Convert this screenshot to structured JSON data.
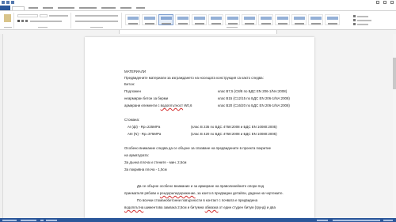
{
  "colors": {
    "accent": "#2b579a",
    "page": "#ffffff",
    "workspace": "#f3f3f3",
    "spellcheck": "#d32f2f"
  },
  "icons": [
    "save-icon",
    "undo-icon",
    "redo-icon",
    "minimize-icon",
    "maximize-icon",
    "close-icon"
  ],
  "document": {
    "lines": {
      "l01": "МАТЕРИАЛИ",
      "l02": "Предвидените материали за изграждането на носещата конструкция са както следва:",
      "l03": "Бетон:",
      "l04": "Подложен",
      "l04b": "клас В7,5 (C8/8 по БДС EN 206-1/NA:2008)",
      "l05": "неармиран бетон за берми",
      "l05b": "клас В15 (C12/15 по БДС EN 206-1/NA:2008)",
      "l06a": "армирани елементи с ",
      "l06red": "водоплътност",
      "l06c": " W0,6",
      "l06b": "клас В20 (C16/20 по БДС EN 206-1/NA:2008)",
      "l07": "Стомана:",
      "l08": "AI (фi) - Rp=225MPa",
      "l08b": "(клас В 235 по БДС 4758:2008 и БДС EN 10080:2005)",
      "l09": "AIII (N) - Rp=375MPa",
      "l09b": "(клас В 420 по БДС 4758:2008 и БДС EN 10080:2005)",
      "l10": "Особено внимание следва да се обърне за спазване на предвидените в проекта покритие",
      "l11": "на арматурата:",
      "l12": "За дънна плоча и стените    - мин. 2,5см",
      "l13": "За покривна плоча                         - 1,5см",
      "l14": "Да се обърне особено внимание и за армиране на праволинейните опори под",
      "l15a": "приемателя рябови и ",
      "l15red": "рендориледерижение",
      "l15c": ", за които в предвидни детайли, дадени на чертежите.",
      "l16": "По всички стоманобетонни повърхности в контакт с почвата е предвидена",
      "l17a": "",
      "l17red": "водоплътна",
      "l17c": " шиментова замазка 2,5см и битумна ",
      "l17red2": "обмазка",
      "l17d": " от един студен битум (грунд) и два"
    }
  }
}
